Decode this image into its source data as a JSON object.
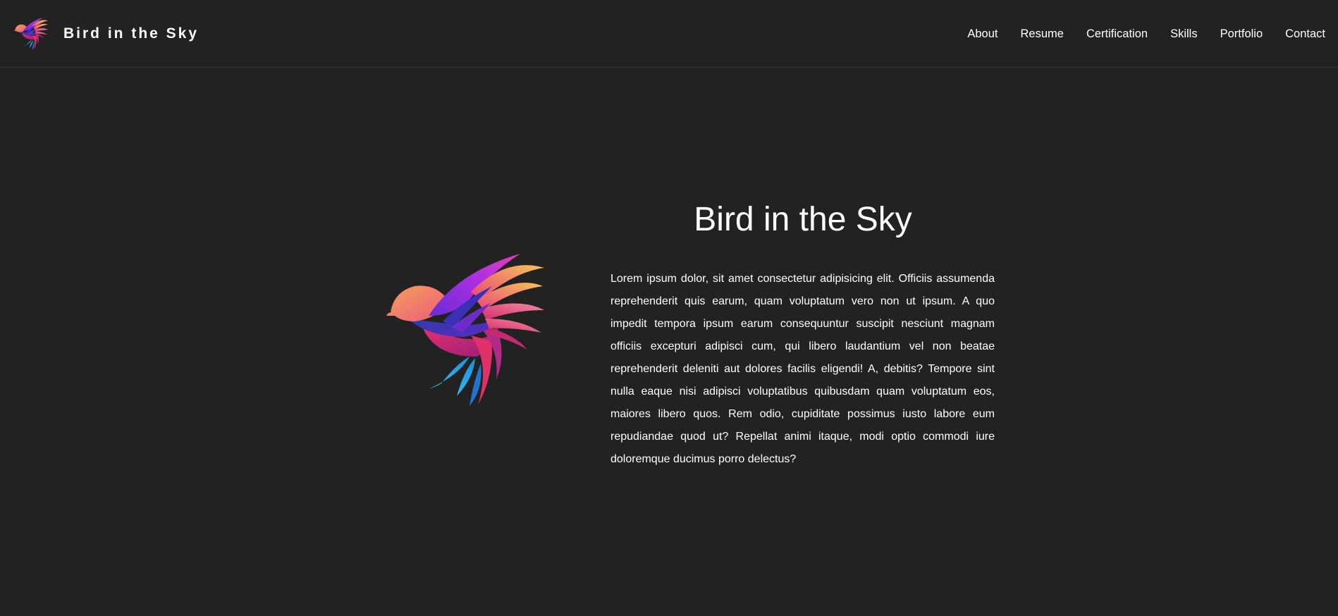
{
  "brand": {
    "name": "Bird in the Sky",
    "logo_icon": "bird-logo-icon"
  },
  "nav": {
    "items": [
      {
        "label": "About"
      },
      {
        "label": "Resume"
      },
      {
        "label": "Certification"
      },
      {
        "label": "Skills"
      },
      {
        "label": "Portfolio"
      },
      {
        "label": "Contact"
      }
    ]
  },
  "hero": {
    "title": "Bird in the Sky",
    "image_icon": "bird-illustration-icon",
    "paragraph": "Lorem ipsum dolor, sit amet consectetur adipisicing elit. Officiis assumenda reprehenderit quis earum, quam voluptatum vero non ut ipsum. A quo impedit tempora ipsum earum consequuntur suscipit nesciunt magnam officiis excepturi adipisci cum, qui libero laudantium vel non beatae reprehenderit deleniti aut dolores facilis eligendi! A, debitis? Tempore sint nulla eaque nisi adipisci voluptatibus quibusdam quam voluptatum eos, maiores libero quos. Rem odio, cupiditate possimus iusto labore eum repudiandae quod ut? Repellat animi itaque, modi optio commodi iure doloremque ducimus porro delectus?"
  },
  "colors": {
    "background": "#222222",
    "text": "#ffffff",
    "nav_border": "#333333"
  }
}
